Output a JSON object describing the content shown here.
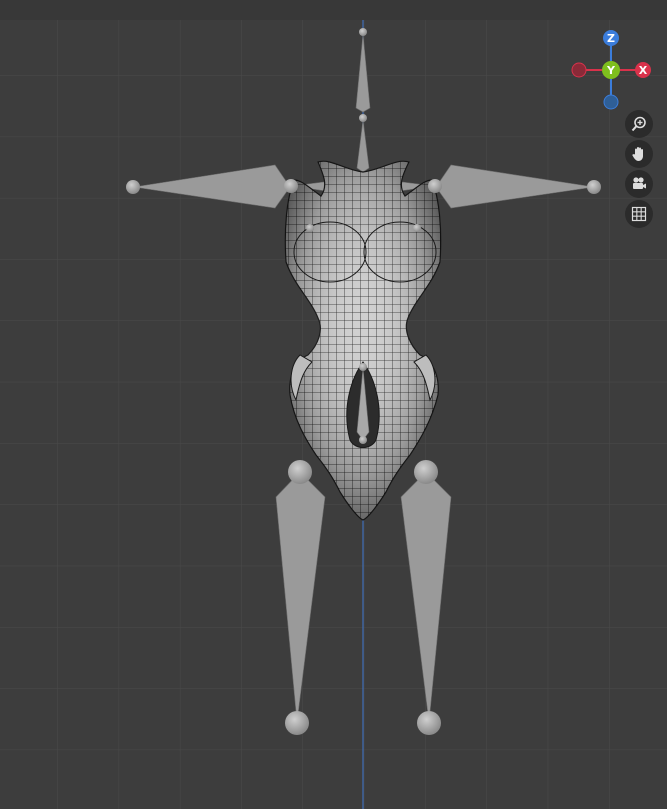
{
  "viewport": {
    "background": "#3d3d3d",
    "grid_color": "#4a4a4a",
    "z_axis_line_color": "#3f6fb8"
  },
  "gizmo": {
    "z_label": "Z",
    "y_label": "Y",
    "x_label": "X",
    "z_color": "#3b7ddc",
    "y_color": "#7fbf1e",
    "x_color": "#d9324b",
    "neg_x_color": "#8a2a38",
    "neg_z_color": "#2f5f97"
  },
  "nav_buttons": [
    {
      "name": "zoom",
      "icon": "magnifier-plus-icon"
    },
    {
      "name": "pan",
      "icon": "hand-icon"
    },
    {
      "name": "camera",
      "icon": "camera-icon"
    },
    {
      "name": "grid-toggle",
      "icon": "grid-icon"
    }
  ],
  "scene": {
    "mesh_color": "#d8d8d8",
    "bone_color": "#9a9a9a"
  }
}
